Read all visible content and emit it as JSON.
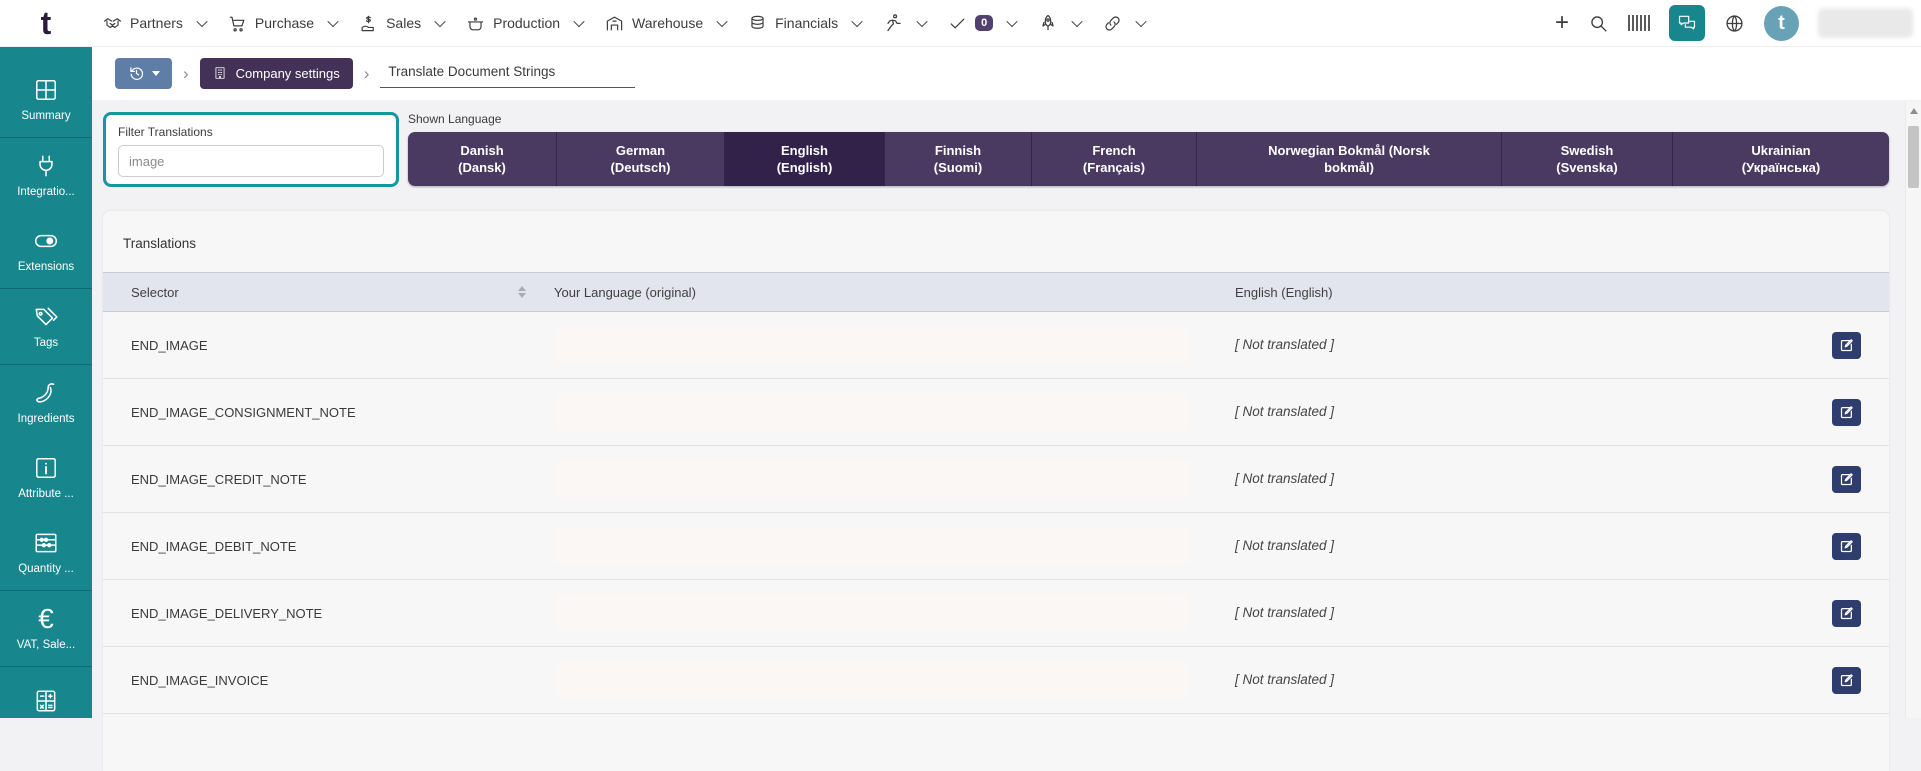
{
  "topbar": {
    "logo_text": "t",
    "menus": [
      {
        "label": "Partners",
        "icon": "handshake-icon"
      },
      {
        "label": "Purchase",
        "icon": "cart-icon"
      },
      {
        "label": "Sales",
        "icon": "hand-money-icon"
      },
      {
        "label": "Production",
        "icon": "pot-icon"
      },
      {
        "label": "Warehouse",
        "icon": "warehouse-icon"
      },
      {
        "label": "Financials",
        "icon": "coins-icon"
      }
    ],
    "icon_menus": [
      "runner-icon",
      "checkmark-icon",
      "rocket-icon",
      "link-icon"
    ],
    "todo_count": "0",
    "avatar_letter": "t"
  },
  "sidebar": {
    "items": [
      {
        "label": "Summary",
        "icon": "grid-icon"
      },
      {
        "label": "Integratio...",
        "icon": "plug-icon"
      },
      {
        "label": "Extensions",
        "icon": "toggle-icon"
      },
      {
        "label": "Tags",
        "icon": "tags-icon"
      },
      {
        "label": "Ingredients",
        "icon": "pepper-icon"
      },
      {
        "label": "Attribute ...",
        "icon": "info-square-icon"
      },
      {
        "label": "Quantity ...",
        "icon": "abacus-icon"
      },
      {
        "label": "VAT, Sale...",
        "icon": "euro-icon"
      },
      {
        "label": "",
        "icon": "calculator-icon"
      }
    ]
  },
  "breadcrumb": {
    "company_settings": "Company settings",
    "current": "Translate Document Strings"
  },
  "filter": {
    "label": "Filter Translations",
    "value": "image"
  },
  "language_bar": {
    "label": "Shown Language",
    "tabs": [
      {
        "line1": "Danish",
        "line2": "(Dansk)",
        "active": false
      },
      {
        "line1": "German",
        "line2": "(Deutsch)",
        "active": false
      },
      {
        "line1": "English",
        "line2": "(English)",
        "active": true
      },
      {
        "line1": "Finnish",
        "line2": "(Suomi)",
        "active": false
      },
      {
        "line1": "French",
        "line2": "(Français)",
        "active": false
      },
      {
        "line1": "Norwegian Bokmål (Norsk",
        "line2": "bokmål)",
        "active": false
      },
      {
        "line1": "Swedish",
        "line2": "(Svenska)",
        "active": false
      },
      {
        "line1": "Ukrainian",
        "line2": "(Українська)",
        "active": false
      }
    ]
  },
  "table": {
    "title": "Translations",
    "columns": {
      "selector": "Selector",
      "original": "Your Language (original)",
      "english": "English (English)"
    },
    "rows": [
      {
        "selector": "END_IMAGE",
        "english": "[ Not translated ]"
      },
      {
        "selector": "END_IMAGE_CONSIGNMENT_NOTE",
        "english": "[ Not translated ]"
      },
      {
        "selector": "END_IMAGE_CREDIT_NOTE",
        "english": "[ Not translated ]"
      },
      {
        "selector": "END_IMAGE_DEBIT_NOTE",
        "english": "[ Not translated ]"
      },
      {
        "selector": "END_IMAGE_DELIVERY_NOTE",
        "english": "[ Not translated ]"
      },
      {
        "selector": "END_IMAGE_INVOICE",
        "english": "[ Not translated ]"
      }
    ]
  },
  "colors": {
    "teal": "#17868d",
    "tab_purple": "#4a3961",
    "tab_purple_active": "#32224a",
    "navy_button": "#2e3c6e",
    "breadcrumb_purple": "#443157",
    "history_blue": "#5e7ea8",
    "header_row": "#e3e5ee"
  }
}
